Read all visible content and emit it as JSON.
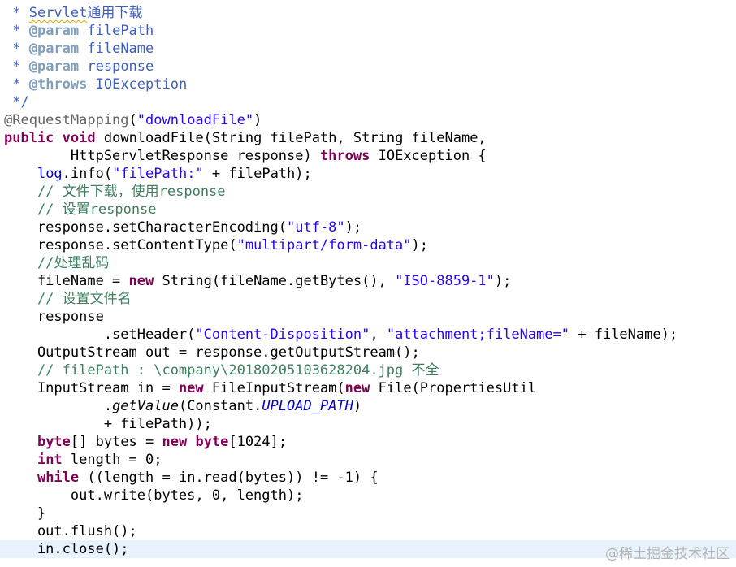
{
  "editor": {
    "language": "java",
    "colors": {
      "doc_comment": "#3f5fbf",
      "line_comment": "#3f7f5f",
      "javadoc_tag": "#7f9fbf",
      "keyword": "#7f0055",
      "string": "#2a00ff",
      "annotation": "#646464",
      "field": "#0000c0",
      "current_line_highlight": "#e8f2fe"
    },
    "lines": [
      [
        {
          "t": " * ",
          "s": "doc"
        },
        {
          "t": "Servlet",
          "s": "doc-squig"
        },
        {
          "t": "通用下载",
          "s": "doc"
        }
      ],
      [
        {
          "t": " * ",
          "s": "doc"
        },
        {
          "t": "@param",
          "s": "tag"
        },
        {
          "t": " filePath",
          "s": "doc"
        }
      ],
      [
        {
          "t": " * ",
          "s": "doc"
        },
        {
          "t": "@param",
          "s": "tag"
        },
        {
          "t": " fileName",
          "s": "doc"
        }
      ],
      [
        {
          "t": " * ",
          "s": "doc"
        },
        {
          "t": "@param",
          "s": "tag"
        },
        {
          "t": " response",
          "s": "doc"
        }
      ],
      [
        {
          "t": " * ",
          "s": "doc"
        },
        {
          "t": "@throws",
          "s": "tag"
        },
        {
          "t": " IOException",
          "s": "doc"
        }
      ],
      [
        {
          "t": " */",
          "s": "doc"
        }
      ],
      [
        {
          "t": "@RequestMapping",
          "s": "ann"
        },
        {
          "t": "(",
          "s": "plain"
        },
        {
          "t": "\"downloadFile\"",
          "s": "str"
        },
        {
          "t": ")",
          "s": "plain"
        }
      ],
      [
        {
          "t": "public",
          "s": "kw"
        },
        {
          "t": " ",
          "s": "plain"
        },
        {
          "t": "void",
          "s": "kw"
        },
        {
          "t": " downloadFile(String filePath, String fileName,",
          "s": "plain"
        }
      ],
      [
        {
          "t": "        HttpServletResponse response) ",
          "s": "plain"
        },
        {
          "t": "throws",
          "s": "kw"
        },
        {
          "t": " IOException {",
          "s": "plain"
        }
      ],
      [
        {
          "t": "    ",
          "s": "plain"
        },
        {
          "t": "log",
          "s": "field"
        },
        {
          "t": ".info(",
          "s": "plain"
        },
        {
          "t": "\"filePath:\"",
          "s": "str"
        },
        {
          "t": " + filePath);",
          "s": "plain"
        }
      ],
      [
        {
          "t": "    // 文件下载，使用response",
          "s": "comment"
        }
      ],
      [
        {
          "t": "    // 设置response",
          "s": "comment"
        }
      ],
      [
        {
          "t": "    response.setCharacterEncoding(",
          "s": "plain"
        },
        {
          "t": "\"utf-8\"",
          "s": "str"
        },
        {
          "t": ");",
          "s": "plain"
        }
      ],
      [
        {
          "t": "    response.setContentType(",
          "s": "plain"
        },
        {
          "t": "\"multipart/form-data\"",
          "s": "str"
        },
        {
          "t": ");",
          "s": "plain"
        }
      ],
      [
        {
          "t": "    //处理乱码",
          "s": "comment"
        }
      ],
      [
        {
          "t": "    fileName = ",
          "s": "plain"
        },
        {
          "t": "new",
          "s": "kw"
        },
        {
          "t": " String(fileName.getBytes(), ",
          "s": "plain"
        },
        {
          "t": "\"ISO-8859-1\"",
          "s": "str"
        },
        {
          "t": ");",
          "s": "plain"
        }
      ],
      [
        {
          "t": "    // 设置文件名",
          "s": "comment"
        }
      ],
      [
        {
          "t": "    response",
          "s": "plain"
        }
      ],
      [
        {
          "t": "            .setHeader(",
          "s": "plain"
        },
        {
          "t": "\"Content-Disposition\"",
          "s": "str"
        },
        {
          "t": ", ",
          "s": "plain"
        },
        {
          "t": "\"attachment;fileName=\"",
          "s": "str"
        },
        {
          "t": " + fileName);",
          "s": "plain"
        }
      ],
      [
        {
          "t": "    OutputStream out = response.getOutputStream();",
          "s": "plain"
        }
      ],
      [
        {
          "t": "    // filePath : \\company\\20180205103628204.jpg 不全",
          "s": "comment"
        }
      ],
      [
        {
          "t": "    InputStream in = ",
          "s": "plain"
        },
        {
          "t": "new",
          "s": "kw"
        },
        {
          "t": " FileInputStream(",
          "s": "plain"
        },
        {
          "t": "new",
          "s": "kw"
        },
        {
          "t": " File(PropertiesUtil",
          "s": "plain"
        }
      ],
      [
        {
          "t": "            .",
          "s": "plain"
        },
        {
          "t": "getValue",
          "s": "italic"
        },
        {
          "t": "(Constant.",
          "s": "plain"
        },
        {
          "t": "UPLOAD_PATH",
          "s": "static"
        },
        {
          "t": ")",
          "s": "plain"
        }
      ],
      [
        {
          "t": "            + filePath));",
          "s": "plain"
        }
      ],
      [
        {
          "t": "    ",
          "s": "plain"
        },
        {
          "t": "byte",
          "s": "kw"
        },
        {
          "t": "[] bytes = ",
          "s": "plain"
        },
        {
          "t": "new",
          "s": "kw"
        },
        {
          "t": " ",
          "s": "plain"
        },
        {
          "t": "byte",
          "s": "kw"
        },
        {
          "t": "[1024];",
          "s": "plain"
        }
      ],
      [
        {
          "t": "    ",
          "s": "plain"
        },
        {
          "t": "int",
          "s": "kw"
        },
        {
          "t": " length = 0;",
          "s": "plain"
        }
      ],
      [
        {
          "t": "    ",
          "s": "plain"
        },
        {
          "t": "while",
          "s": "kw"
        },
        {
          "t": " ((length = in.read(bytes)) != -1) {",
          "s": "plain"
        }
      ],
      [
        {
          "t": "        out.write(bytes, 0, length);",
          "s": "plain"
        }
      ],
      [
        {
          "t": "    }",
          "s": "plain"
        }
      ],
      [
        {
          "t": "    out.flush();",
          "s": "plain"
        }
      ],
      [
        {
          "t": "    in.close();",
          "s": "plain"
        }
      ]
    ],
    "current_line": 30
  },
  "watermark": {
    "text": "@稀土掘金技术社区"
  }
}
